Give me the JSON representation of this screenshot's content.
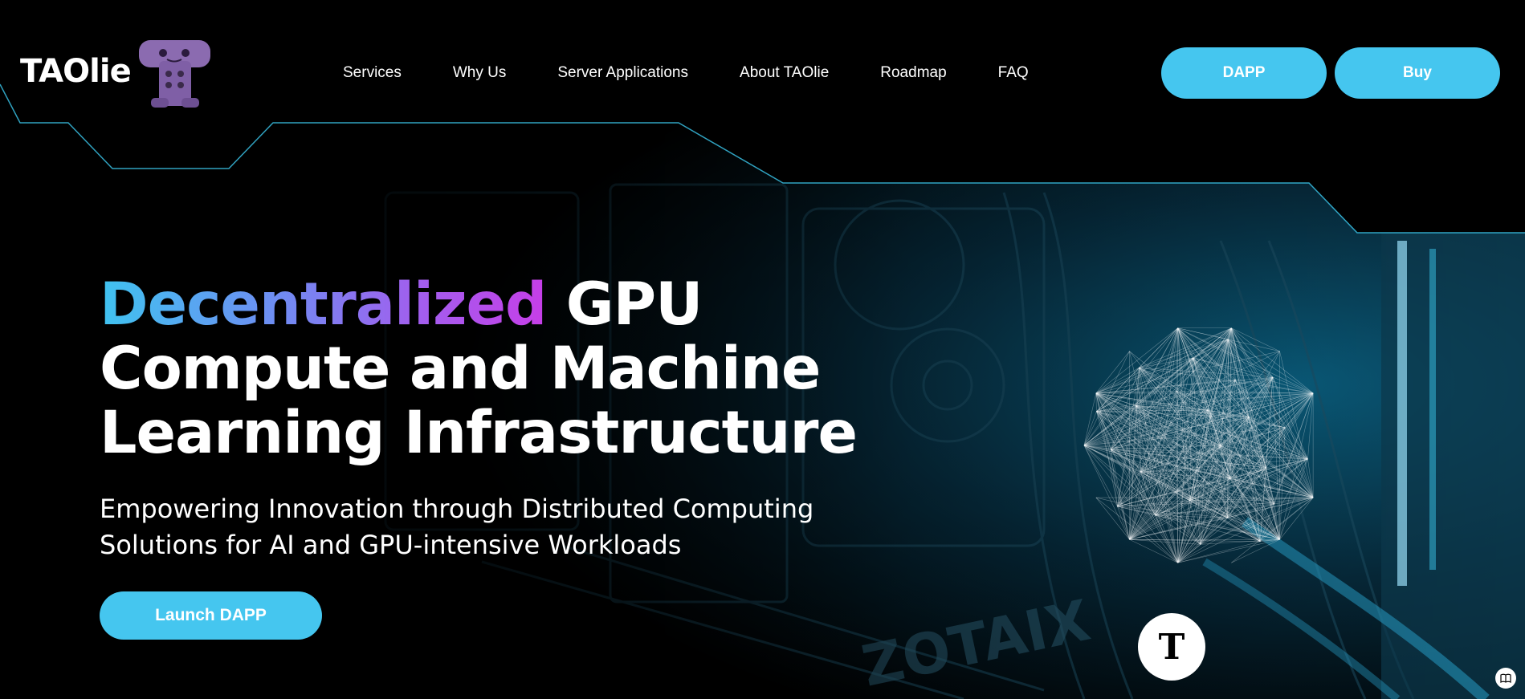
{
  "header": {
    "logo_text": "TAOlie",
    "nav": [
      {
        "label": "Services"
      },
      {
        "label": "Why Us"
      },
      {
        "label": "Server Applications"
      },
      {
        "label": "About TAOlie"
      },
      {
        "label": "Roadmap"
      },
      {
        "label": "FAQ"
      }
    ],
    "dapp_label": "DAPP",
    "buy_label": "Buy"
  },
  "hero": {
    "title_highlight": "Decentralized",
    "title_rest_line1": " GPU",
    "title_line2": "Compute and Machine",
    "title_line3": "Learning Infrastructure",
    "subtitle_line1": "Empowering Innovation through Distributed Computing",
    "subtitle_line2": "Solutions for AI and GPU-intensive Workloads",
    "cta_label": "Launch DAPP"
  },
  "badge": {
    "letter": "T"
  },
  "icons": {
    "mascot": "mascot-robot-icon",
    "sphere": "network-sphere-icon",
    "corner": "book-icon"
  },
  "colors": {
    "accent": "#45c6ef",
    "background": "#000000",
    "gradient_start": "#3fc3f0",
    "gradient_end": "#c63ee8"
  }
}
